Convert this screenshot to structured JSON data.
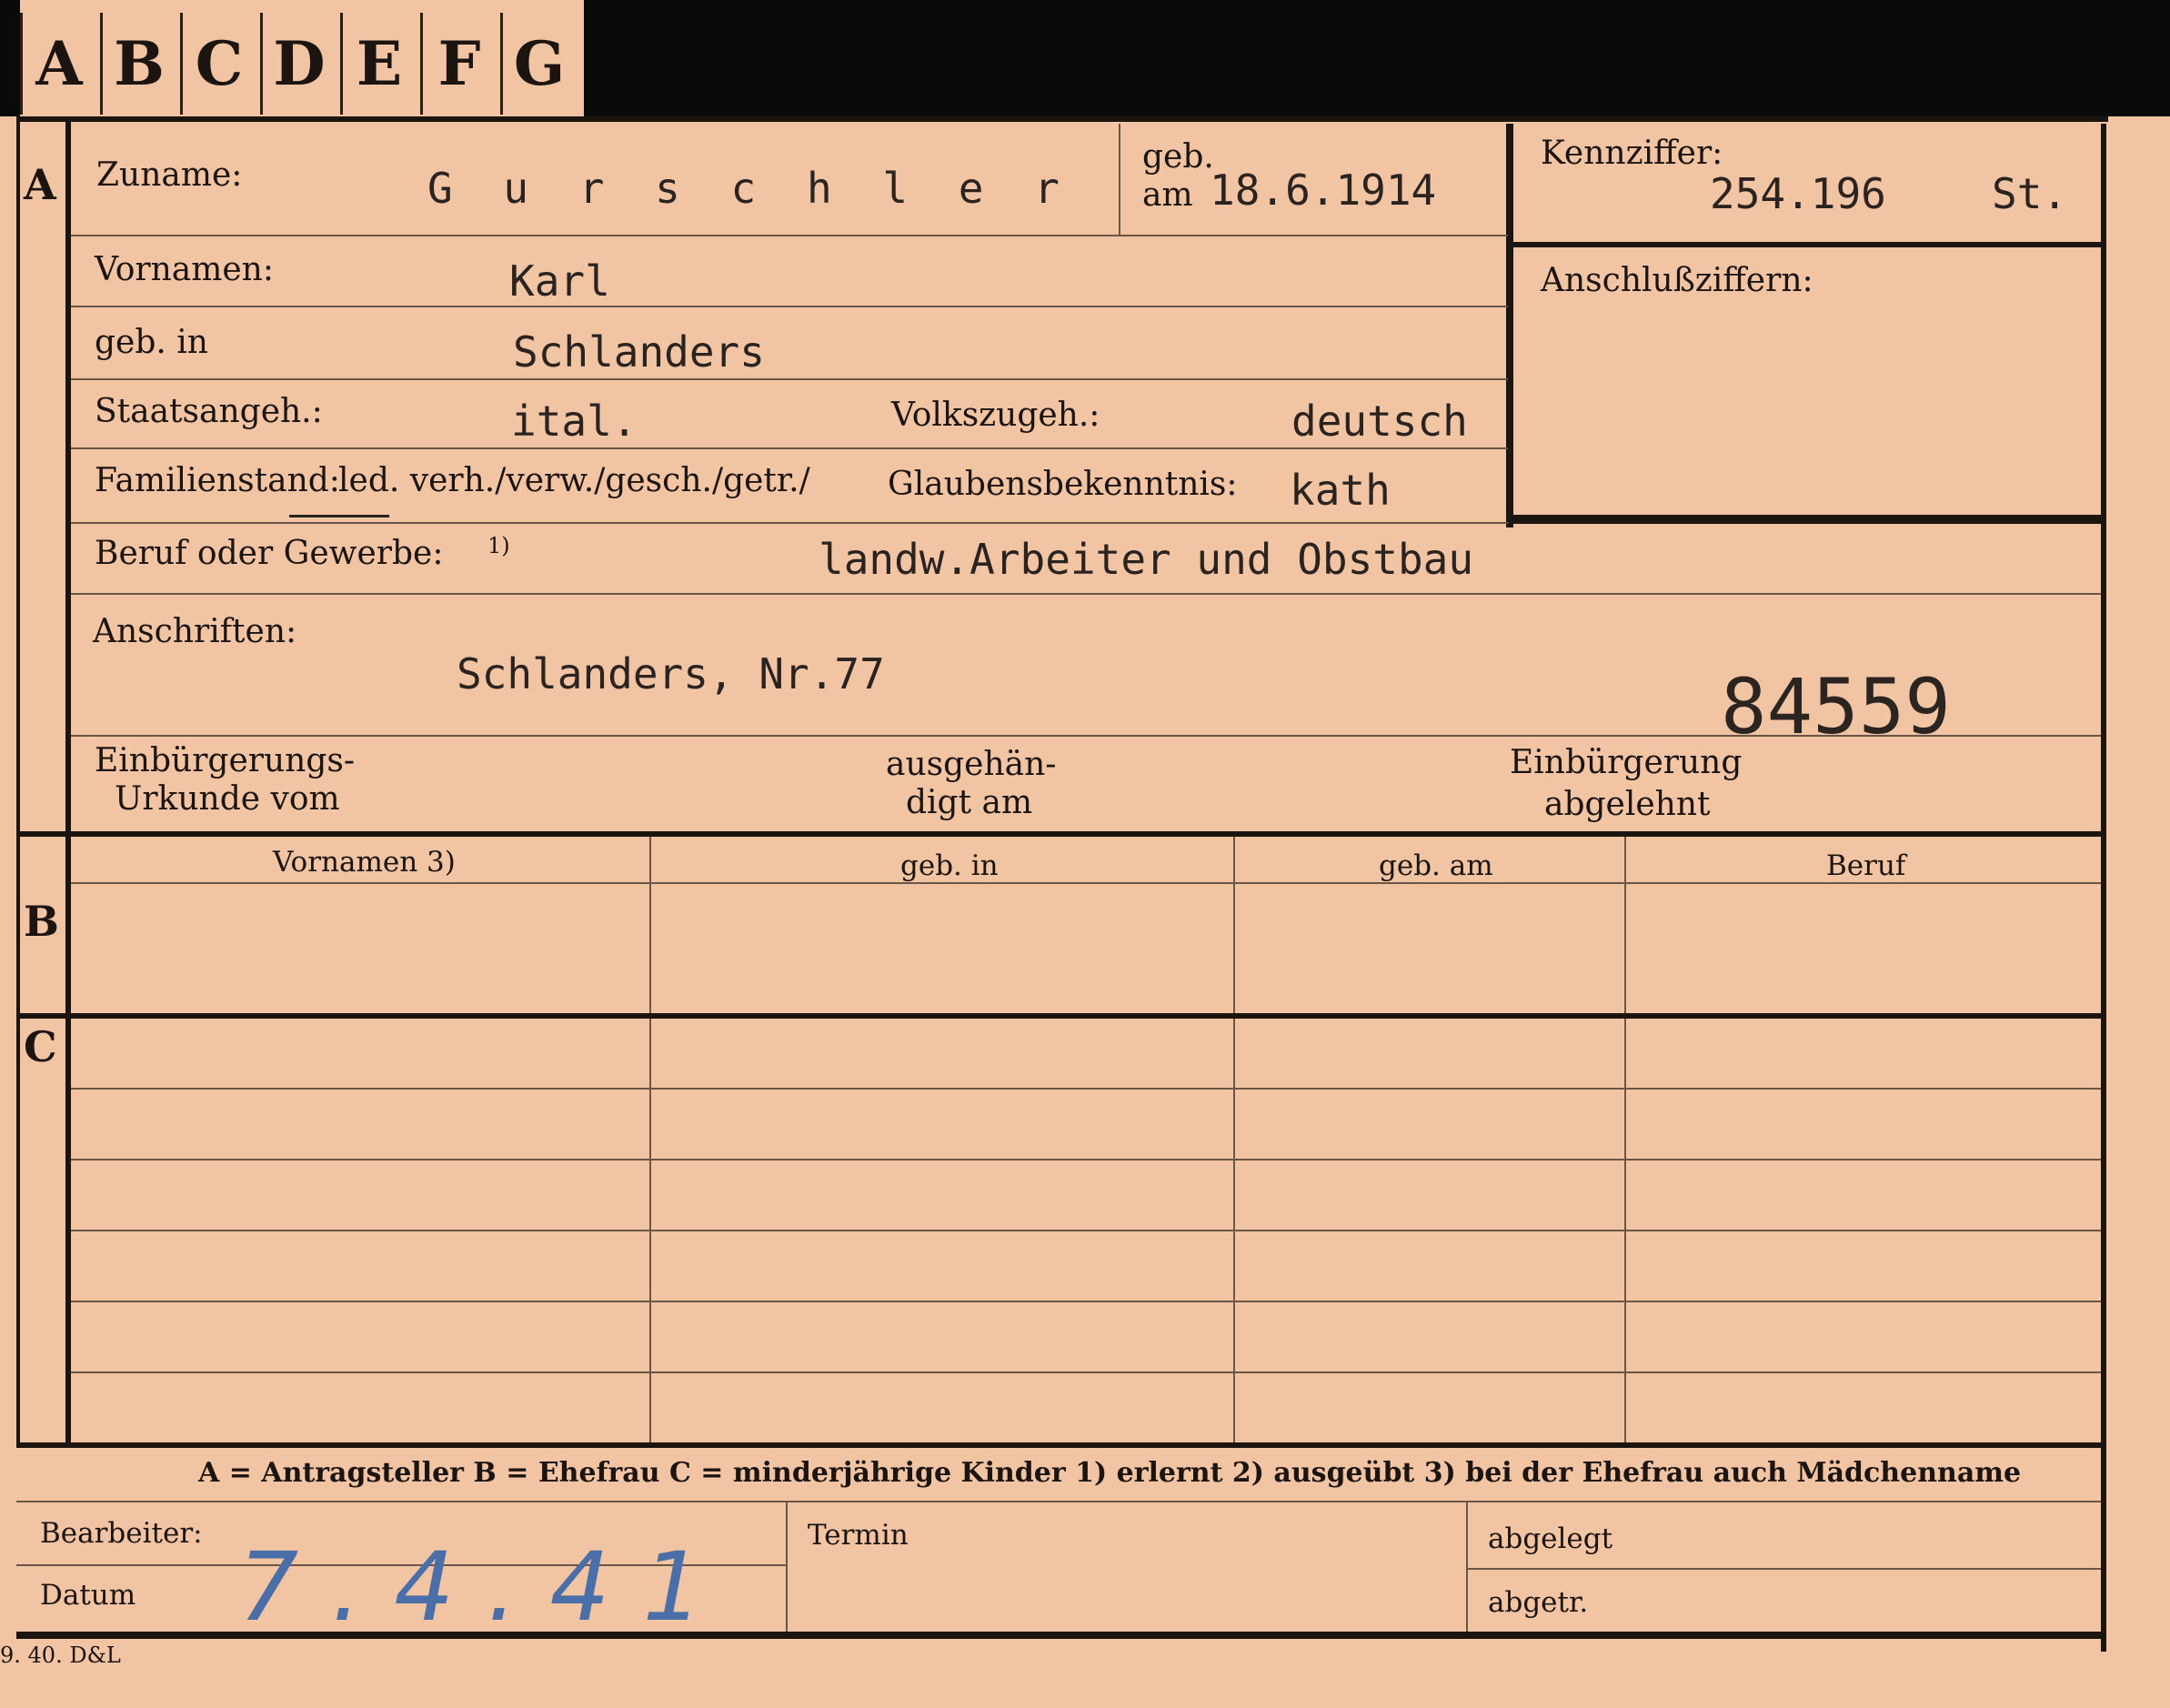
{
  "tabs": [
    "A",
    "B",
    "C",
    "D",
    "E",
    "F",
    "G"
  ],
  "sections": {
    "a": "A",
    "b": "B",
    "c": "C"
  },
  "labels": {
    "zuname": "Zuname:",
    "geb_am_1": "geb.",
    "geb_am_2": "am",
    "kennziffer": "Kennziffer:",
    "anschluss": "Anschlußziffern:",
    "vornamen": "Vornamen:",
    "geb_in": "geb. in",
    "staatsangeh": "Staatsangeh.:",
    "volkszugeh": "Volkszugeh.:",
    "familienstand": "Familienstand:",
    "familienstand_options": "led. verh./verw./gesch./getr./",
    "glaubens": "Glaubensbekenntnis:",
    "beruf": "Beruf oder Gewerbe:",
    "beruf_note": "1)",
    "anschriften": "Anschriften:",
    "einb_urk_1": "Einbürgerungs-",
    "einb_urk_2": "Urkunde vom",
    "ausgeh_1": "ausgehän-",
    "ausgeh_2": "digt am",
    "einb_abg_1": "Einbürgerung",
    "einb_abg_2": "abgelehnt",
    "col_vornamen": "Vornamen 3)",
    "col_geb_in": "geb. in",
    "col_geb_am": "geb. am",
    "col_beruf": "Beruf",
    "legend": "A = Antragsteller   B = Ehefrau   C = minderjährige Kinder   1) erlernt   2) ausgeübt   3) bei der Ehefrau auch Mädchenname",
    "bearbeiter": "Bearbeiter:",
    "datum": "Datum",
    "termin": "Termin",
    "abgelegt": "abgelegt",
    "abgetr": "abgetr.",
    "print_code": "9. 40. D&L"
  },
  "values": {
    "zuname": "G u r s c h l e r",
    "geb_am": "18.6.1914",
    "kennziffer": "254.196",
    "kennziffer_suffix": "St.",
    "vornamen": "Karl",
    "geb_in": "Schlanders",
    "staatsangeh": "ital.",
    "volkszugeh": "deutsch",
    "glaubens": "kath",
    "beruf": "landw.Arbeiter und Obstbau",
    "anschrift": "Schlanders, Nr.77",
    "stamp_number": "84559",
    "datum": "7.4.41"
  }
}
